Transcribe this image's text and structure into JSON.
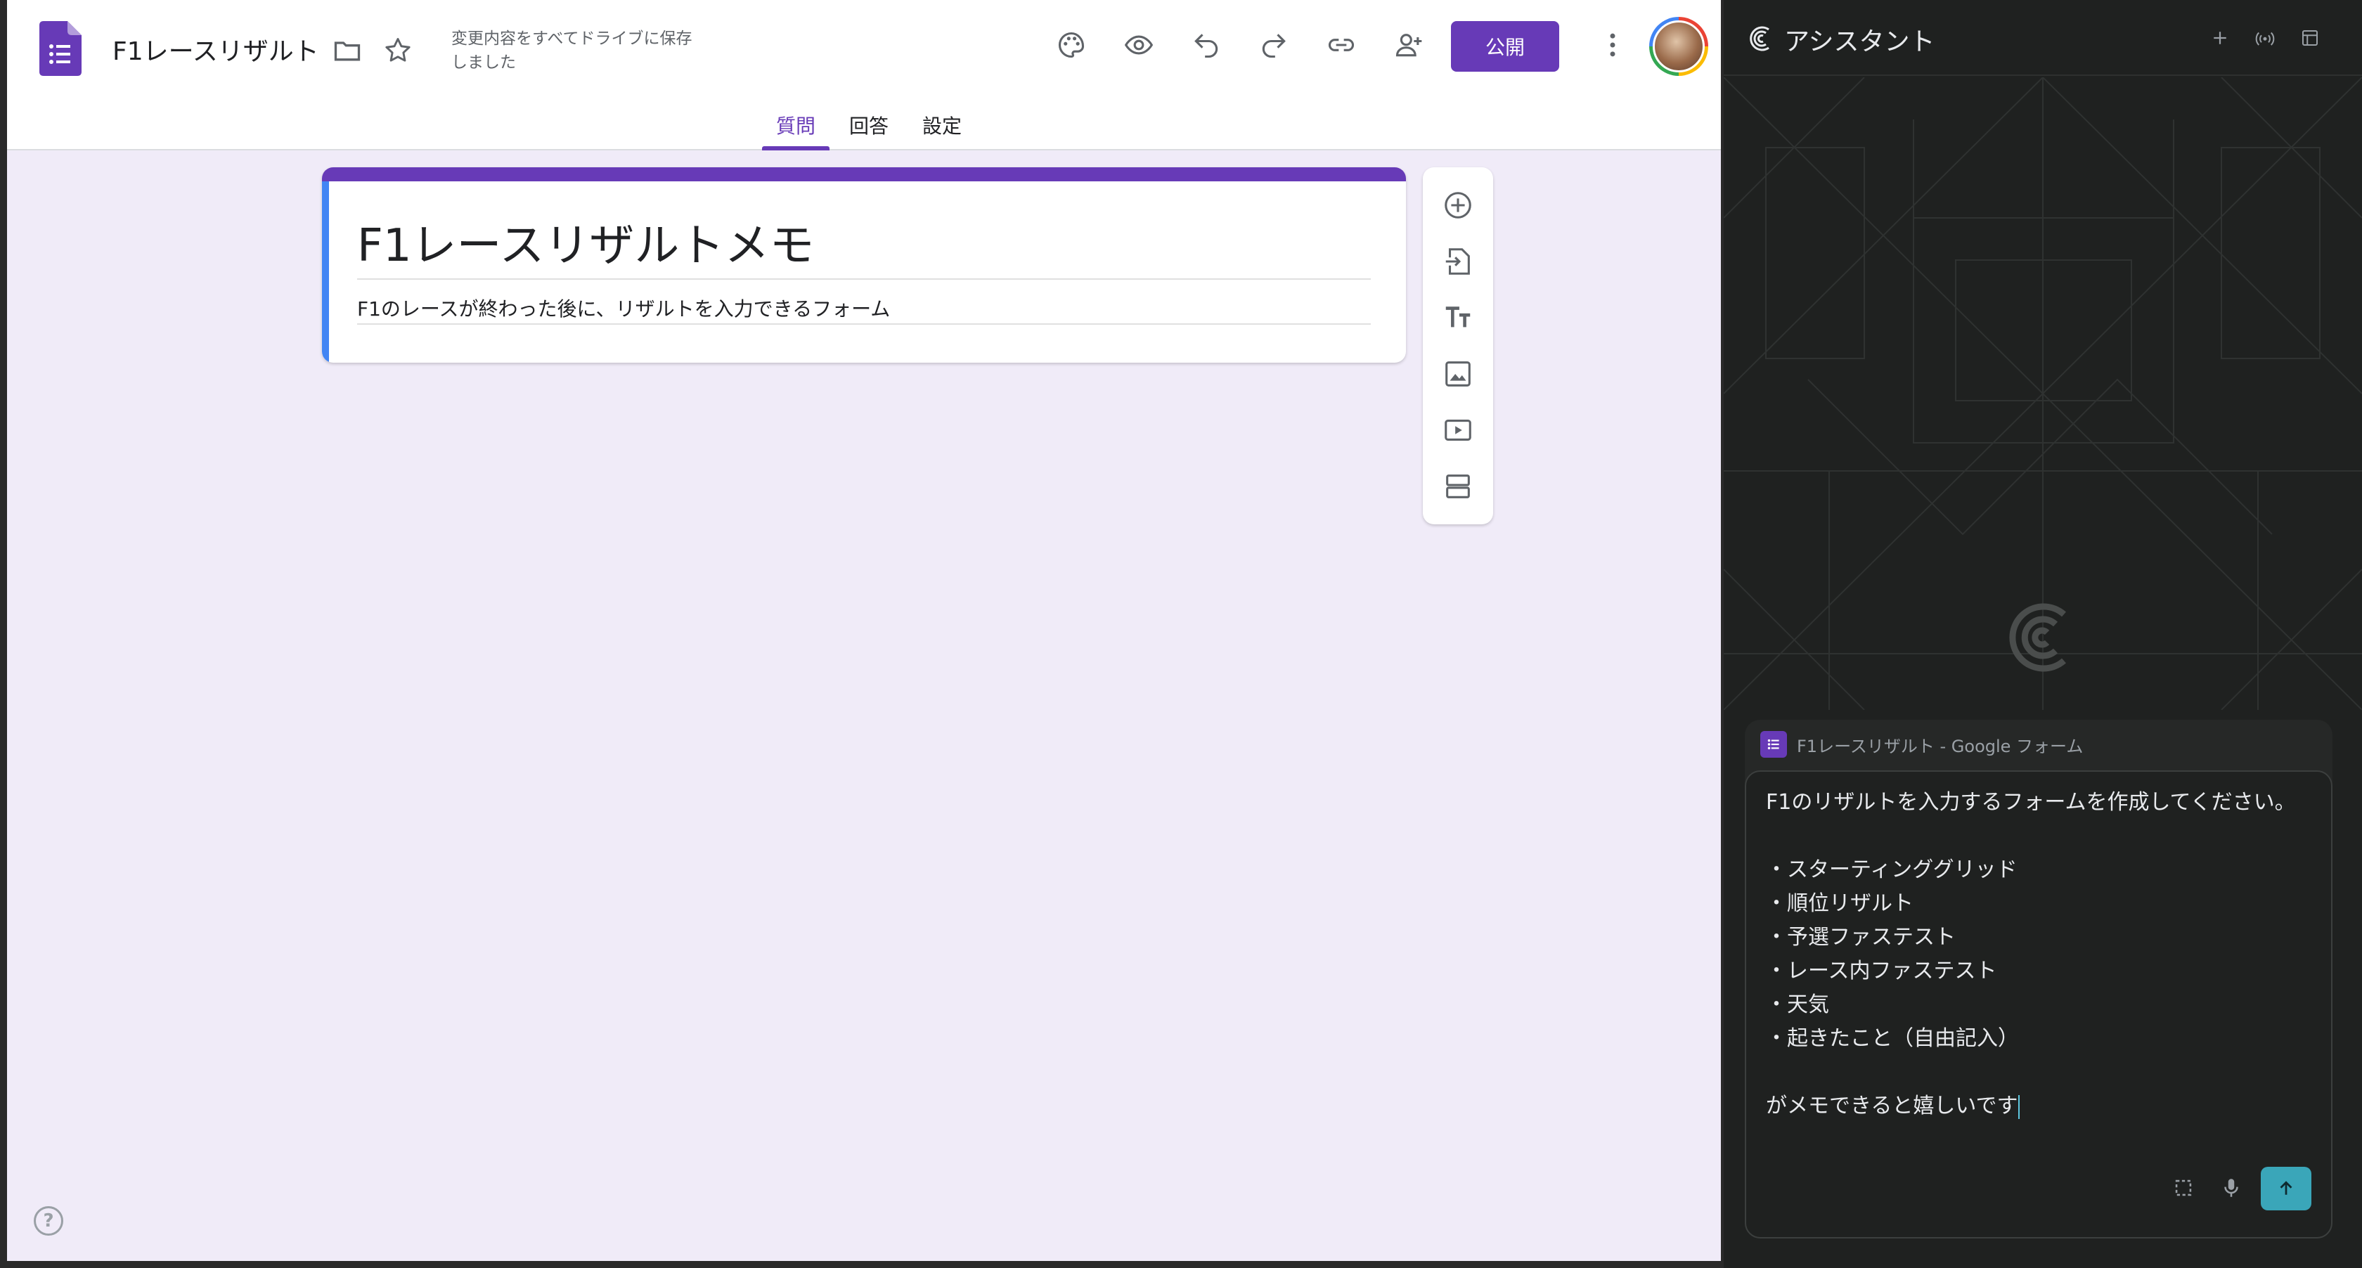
{
  "forms": {
    "document_title": "F1レースリザルト",
    "save_status": "変更内容をすべてドライブに保存しました",
    "publish_label": "公開",
    "tabs": [
      {
        "label": "質問",
        "active": true
      },
      {
        "label": "回答",
        "active": false
      },
      {
        "label": "設定",
        "active": false
      }
    ],
    "form": {
      "title": "F1レースリザルトメモ",
      "description": "F1のレースが終わった後に、リザルトを入力できるフォーム"
    },
    "toolbar_icons": [
      "add-question-icon",
      "import-questions-icon",
      "add-title-icon",
      "add-image-icon",
      "add-video-icon",
      "add-section-icon"
    ],
    "help_label": "?",
    "colors": {
      "accent": "#673ab7",
      "background": "#f0ebf8",
      "title_bar": "#4285f4"
    }
  },
  "assistant": {
    "title": "アシスタント",
    "context_label": "F1レースリザルト - Google フォーム",
    "message": "F1のリザルトを入力するフォームを作成してください。\n\n・スターティンググリッド\n・順位リザルト\n・予選ファステスト\n・レース内ファステスト\n・天気\n・起きたこと（自由記入）\n\nがメモできると嬉しいです",
    "colors": {
      "background": "#1f2120",
      "send_button": "#3aa6b9"
    }
  }
}
